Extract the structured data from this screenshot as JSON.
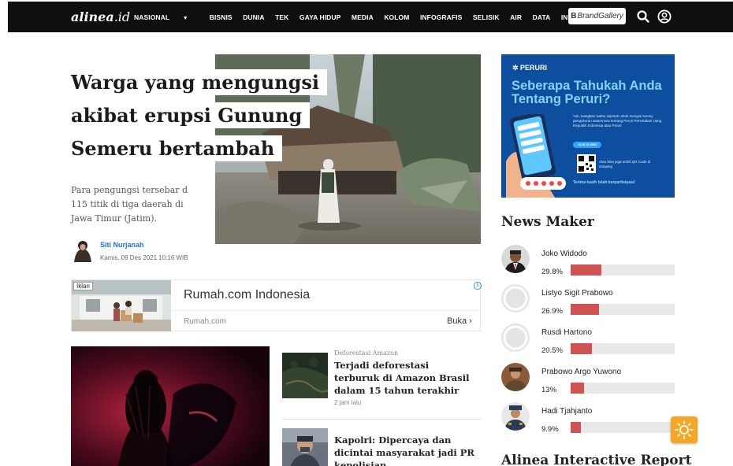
{
  "nav": {
    "logo_main": "alinea",
    "logo_tld": ".id",
    "items": [
      "NASIONAL",
      "BISNIS",
      "DUNIA",
      "TEK",
      "GAYA HIDUP",
      "MEDIA",
      "KOLOM",
      "INFOGRAFIS",
      "SELISIK",
      "AIR",
      "DATA",
      "INDEKS"
    ],
    "brand_prefix": "B",
    "brand_label": "BrandGallery",
    "icons": [
      "chevron-down-icon",
      "search-icon",
      "user-icon"
    ]
  },
  "hero": {
    "title_lines": [
      "Warga yang mengungsi",
      "akibat erupsi Gunung",
      "Semeru bertambah"
    ],
    "subtitle": "Para pengungsi tersebar d 115 titik di tiga daerah di Jawa Timur (Jatim).",
    "author": "Siti Nurjanah",
    "date": "Kamis, 09 Des 2021 10:16 WIB"
  },
  "ad": {
    "tag": "Iklan",
    "title": "Rumah.com Indonesia",
    "url": "Rumah.com",
    "cta": "Buka",
    "icons": [
      "info-icon",
      "chevron-right-icon"
    ]
  },
  "stories": [
    {
      "kicker": "Deforestasi Amazon",
      "title": "Terjadi deforestasi terburuk di Amazon Brasil dalam 15 tahun terakhir",
      "time": "2 jam lalu"
    },
    {
      "title": "Kapolri: Dipercaya dan dicintai masyarakat jadi PR kepolisian"
    }
  ],
  "peruri_ad": {
    "logo": "PERURI",
    "headline": "Seberapa Tahukah Anda Tentang Peruri?",
    "body": "Yuk, luangkan waktu sejenak untuk mengisi survey pengukuran awareness tentang Peruri Percetakan Uang Republik Indonesia atau Peruri",
    "button": "KLIK DI SINI",
    "qr_text": "Atau bisa juga ambil QR Code di samping",
    "footer": "Terima kasih telah berpartisipasi!"
  },
  "news_maker": {
    "title": "News Maker",
    "items": [
      {
        "name": "Joko Widodo",
        "pct": "29.8%",
        "value": 0.298
      },
      {
        "name": "Listyo Sigit Prabowo",
        "pct": "26.9%",
        "value": 0.269
      },
      {
        "name": "Rusdi Hartono",
        "pct": "20.5%",
        "value": 0.205
      },
      {
        "name": "Prabowo Argo Yuwono",
        "pct": "13%",
        "value": 0.13
      },
      {
        "name": "Hadi Tjahjanto",
        "pct": "9.9%",
        "value": 0.099
      }
    ]
  },
  "report": {
    "title": "Alinea Interactive Report"
  },
  "fab": {
    "icon": "sun-icon"
  },
  "colors": {
    "nav_bg": "#0f0f0f",
    "accent_link": "#1e73d6",
    "bar_fill": "#d05353",
    "bar_track": "#e9e9e9",
    "peruri_bg": "#0d4f9e",
    "fab": "#f5a623"
  }
}
